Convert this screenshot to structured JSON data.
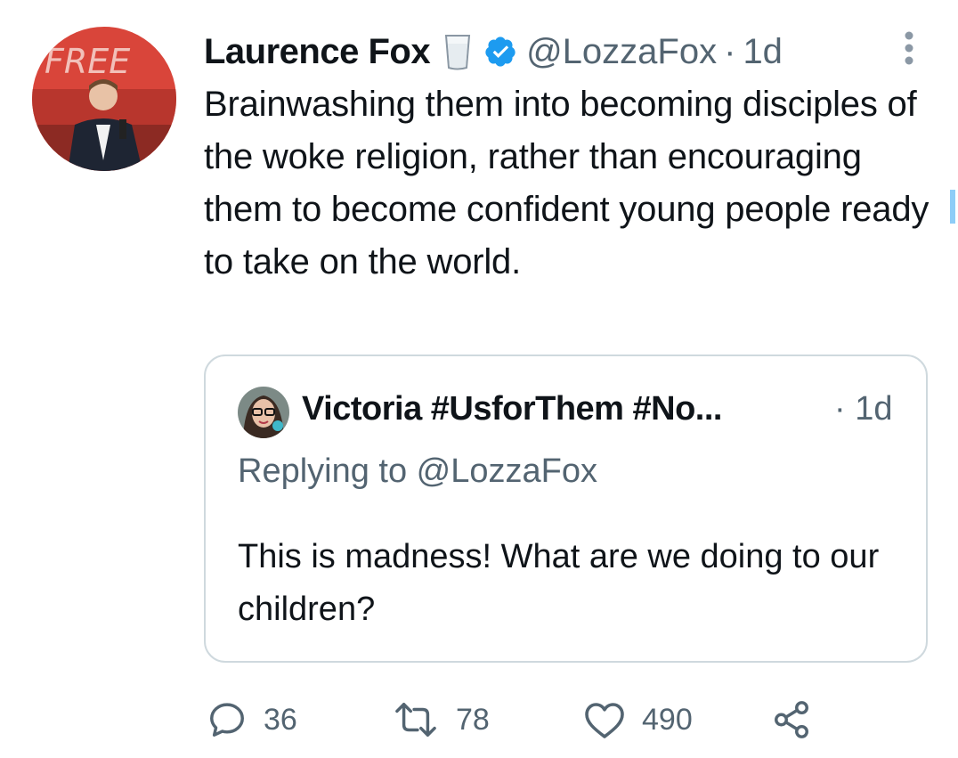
{
  "tweet": {
    "author_name": "Laurence Fox",
    "handle": "@LozzaFox",
    "separator": "·",
    "time": "1d",
    "text": "Brainwashing them into becoming disciples of the woke religion, rather than encouraging them to become confident young people ready to take on the world.",
    "avatar_icon": "profile-photo",
    "name_emoji_icon": "glass-of-milk-icon",
    "verified_icon": "verified-badge-icon"
  },
  "quoted_tweet": {
    "author_name": "Victoria #UsforThem #No...",
    "time": "· 1d",
    "replying_to": "Replying to @LozzaFox",
    "text": "This is madness! What are we doing to our children?"
  },
  "actions": {
    "reply_count": "36",
    "retweet_count": "78",
    "like_count": "490"
  },
  "colors": {
    "text": "#0f1419",
    "secondary": "#536471",
    "verified": "#1d9bf0",
    "border": "#cfd9de",
    "avatar_bg": "#d9453a"
  }
}
